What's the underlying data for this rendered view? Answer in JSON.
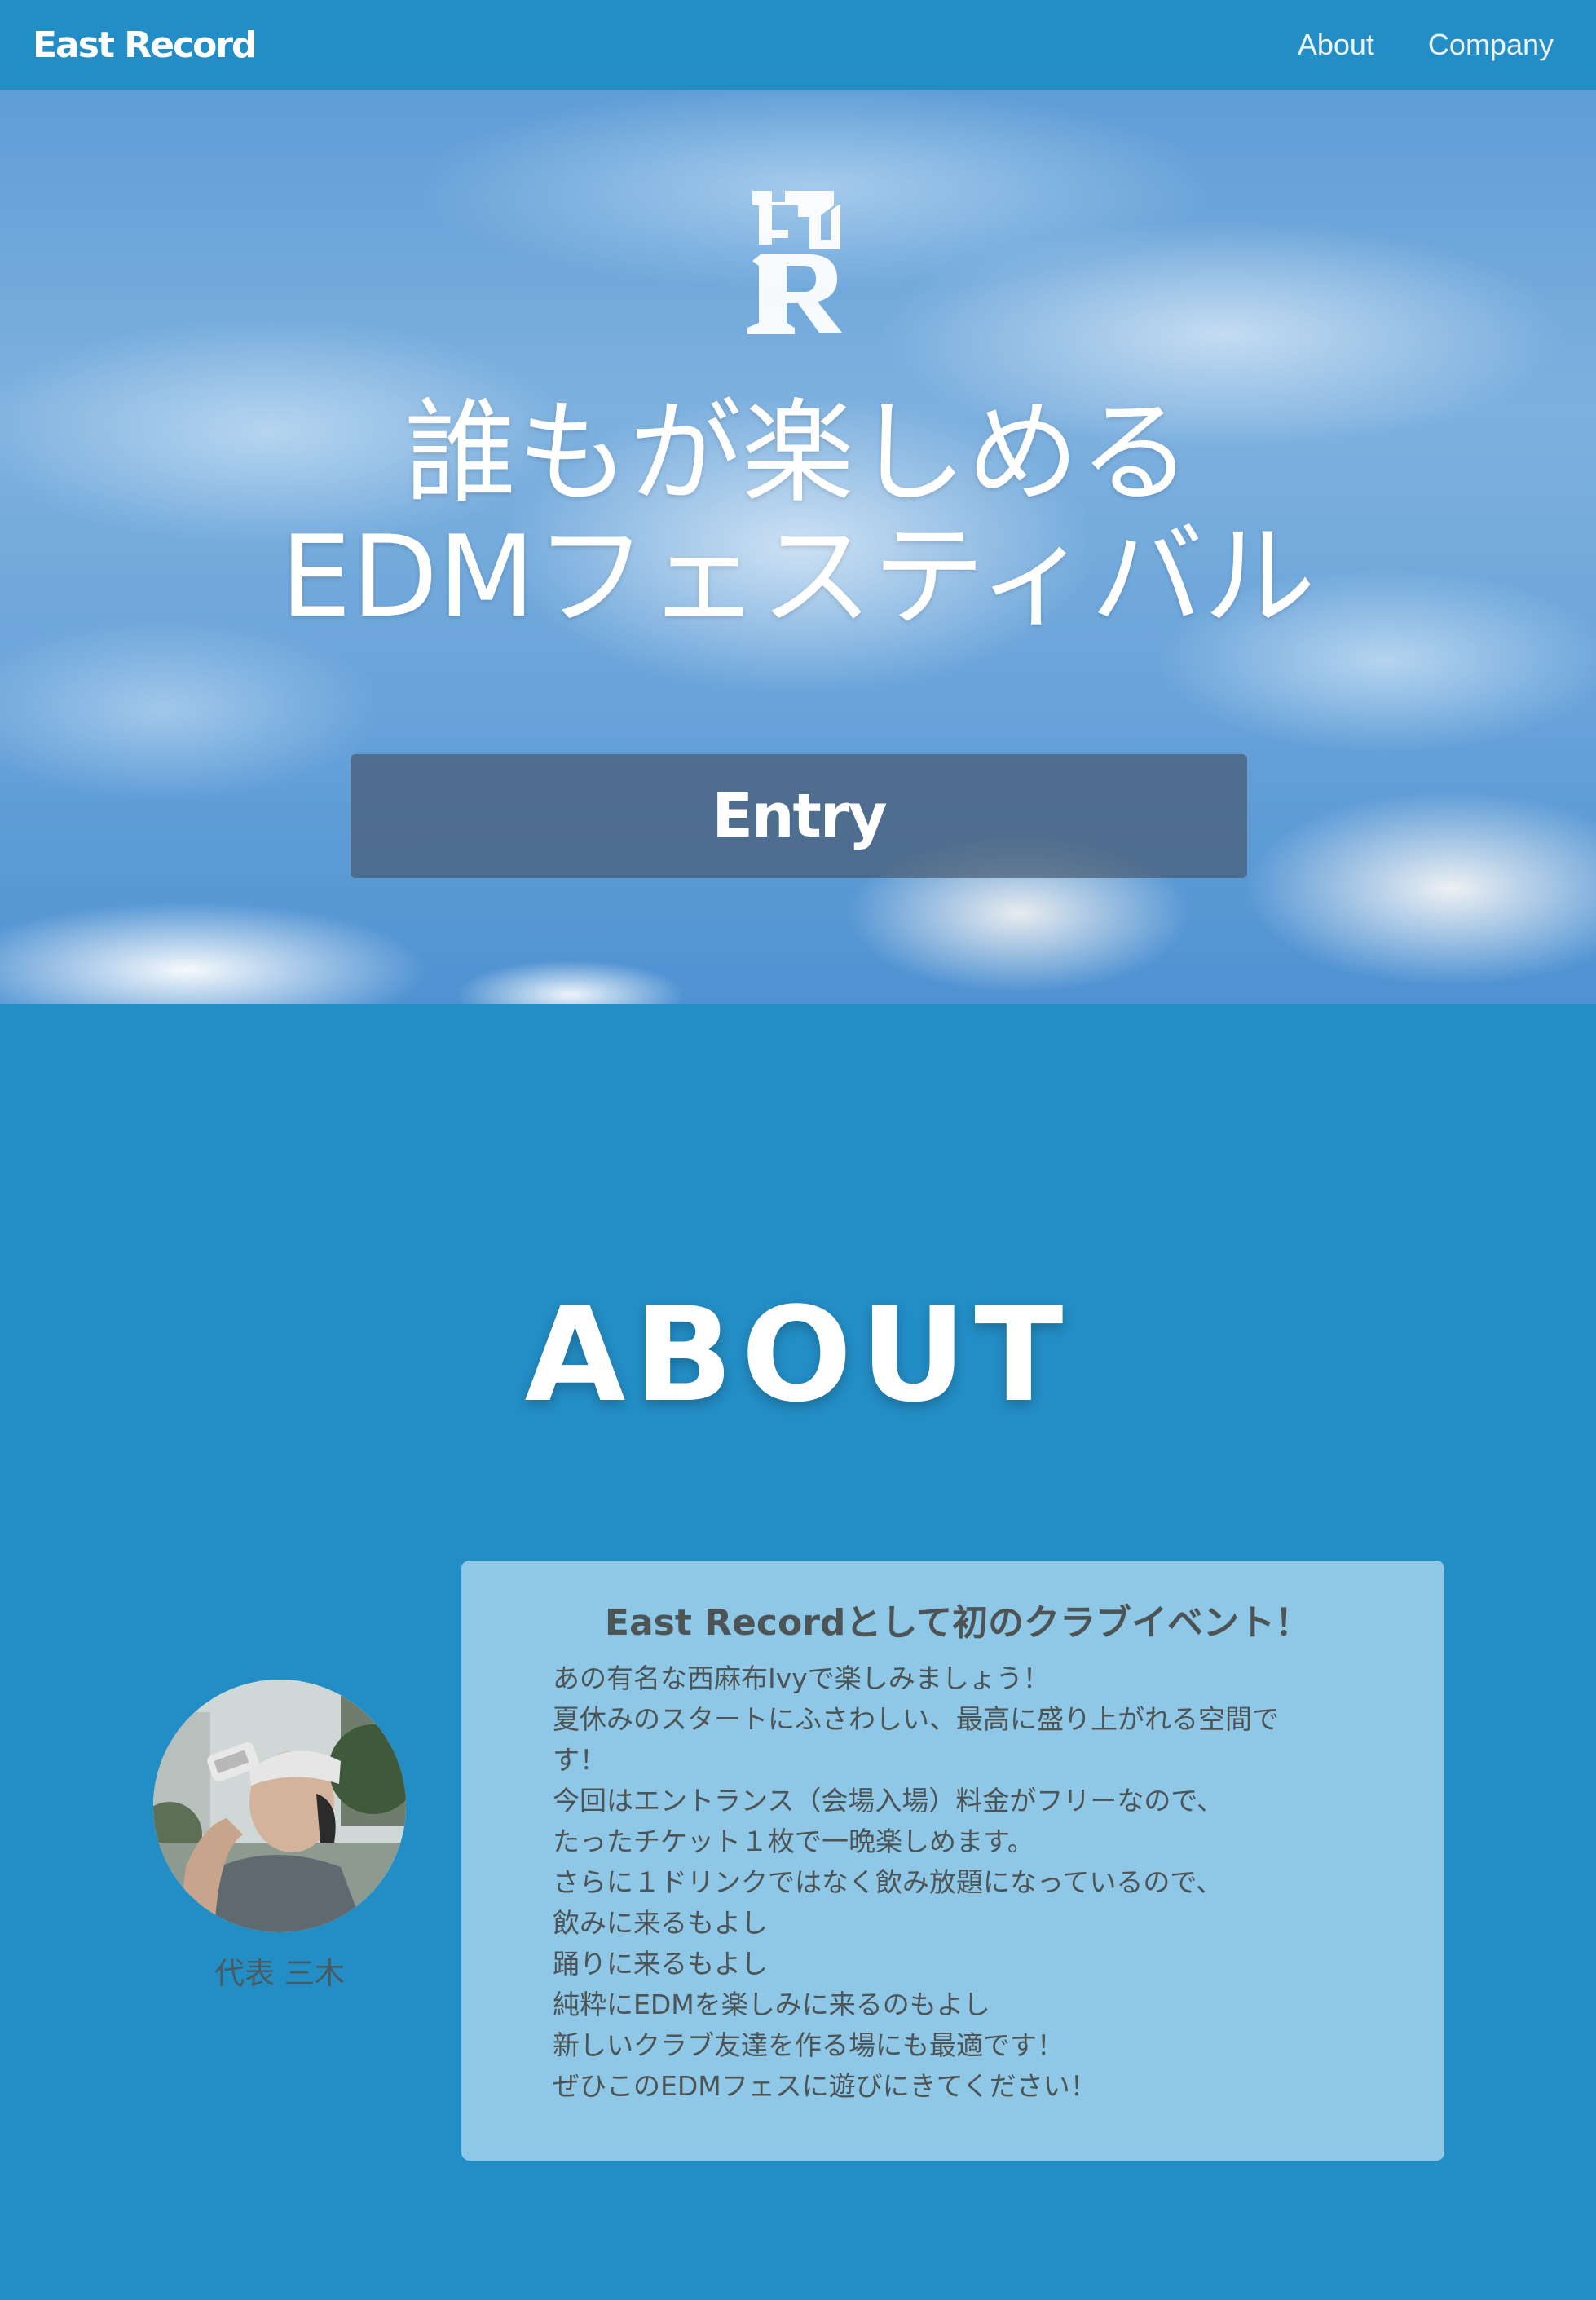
{
  "header": {
    "brand": "East Record",
    "nav": [
      {
        "label": "About"
      },
      {
        "label": "Company"
      }
    ]
  },
  "hero": {
    "logo_icon": "east-record-er-logo",
    "title_line1": "誰もが楽しめる",
    "title_line2": "EDMフェスティバル",
    "entry_label": "Entry"
  },
  "about": {
    "heading": "ABOUT",
    "profile": {
      "caption": "代表 三木"
    },
    "card": {
      "title": "East Recordとして初のクラブイベント！",
      "lines": [
        "あの有名な西麻布Ivyで楽しみましょう！",
        "夏休みのスタートにふさわしい、最高に盛り上がれる空間で",
        "す！",
        "今回はエントランス（会場入場）料金がフリーなので、",
        "たったチケット１枚で一晩楽しめます。",
        "さらに１ドリンクではなく飲み放題になっているので、",
        "飲みに来るもよし",
        "踊りに来るもよし",
        "純粋にEDMを楽しみに来るのもよし",
        "新しいクラブ友達を作る場にも最適です！",
        "ぜひこのEDMフェスに遊びにきてください！"
      ]
    }
  },
  "colors": {
    "primary": "#238dc5",
    "card_bg": "#8fc8e7",
    "text_dark": "#4d5456",
    "white": "#ffffff"
  }
}
